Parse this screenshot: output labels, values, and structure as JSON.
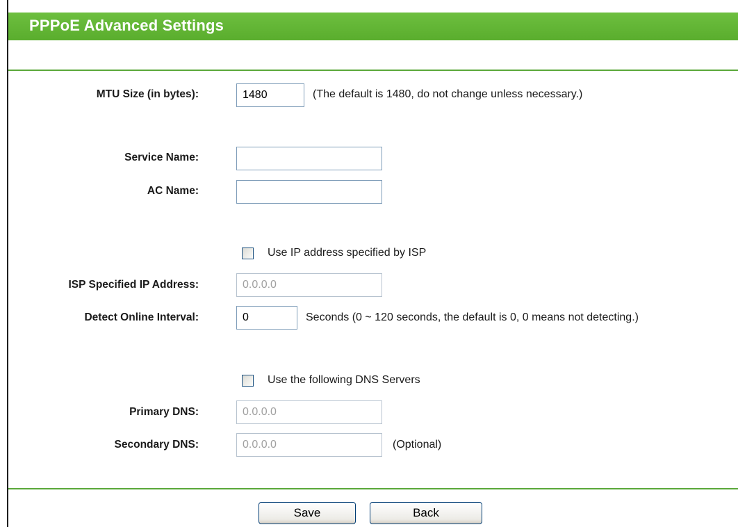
{
  "header": {
    "title": "PPPoE Advanced Settings"
  },
  "form": {
    "mtu": {
      "label": "MTU Size (in bytes):",
      "value": "1480",
      "hint": "(The default is 1480, do not change unless necessary.)"
    },
    "service_name": {
      "label": "Service Name:",
      "value": ""
    },
    "ac_name": {
      "label": "AC Name:",
      "value": ""
    },
    "use_isp_ip": {
      "label": "Use IP address specified by ISP",
      "checked": false
    },
    "isp_ip": {
      "label": "ISP Specified IP Address:",
      "value": "0.0.0.0",
      "disabled": true
    },
    "detect_interval": {
      "label": "Detect Online Interval:",
      "value": "0",
      "hint": "Seconds (0 ~ 120 seconds, the default is 0, 0 means not detecting.)"
    },
    "use_dns": {
      "label": "Use the following DNS Servers",
      "checked": false
    },
    "primary_dns": {
      "label": "Primary DNS:",
      "value": "0.0.0.0",
      "disabled": true
    },
    "secondary_dns": {
      "label": "Secondary DNS:",
      "value": "0.0.0.0",
      "hint": "(Optional)",
      "disabled": true
    }
  },
  "buttons": {
    "save": "Save",
    "back": "Back"
  },
  "colors": {
    "title_bar": "#5aad2d",
    "rule": "#5aa83a"
  },
  "icons": {
    "checkbox": "checkbox-icon"
  }
}
